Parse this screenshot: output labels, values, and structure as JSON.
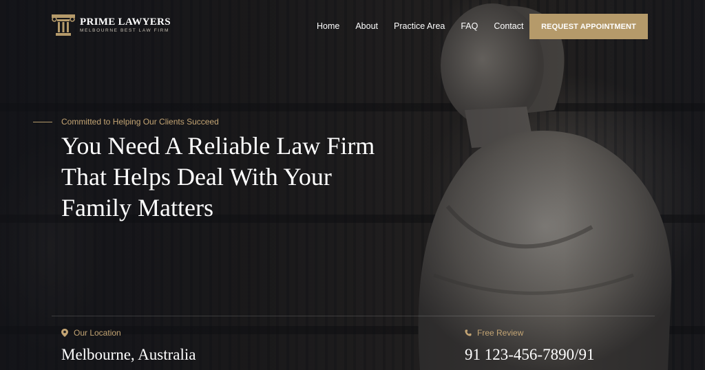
{
  "brand": {
    "name": "PRIME LAWYERS",
    "tagline": "MELBOURNE BEST LAW FIRM",
    "logo_icon": "pillar-icon"
  },
  "nav": {
    "items": [
      "Home",
      "About",
      "Practice Area",
      "FAQ",
      "Contact"
    ],
    "cta_label": "REQUEST APPOINTMENT"
  },
  "hero": {
    "eyebrow": "Committed to Helping Our Clients Succeed",
    "headline_lines": [
      "You Need A Reliable Law Firm",
      "That Helps Deal With Your",
      "Family Matters"
    ]
  },
  "info": {
    "location": {
      "label": "Our Location",
      "value": "Melbourne, Australia",
      "icon": "map-pin-icon"
    },
    "review": {
      "label": "Free Review",
      "value": "91 123-456-7890/91",
      "icon": "phone-icon"
    }
  },
  "colors": {
    "accent": "#b59a6a",
    "accent_text": "#c4a574",
    "background": "#14161b"
  }
}
